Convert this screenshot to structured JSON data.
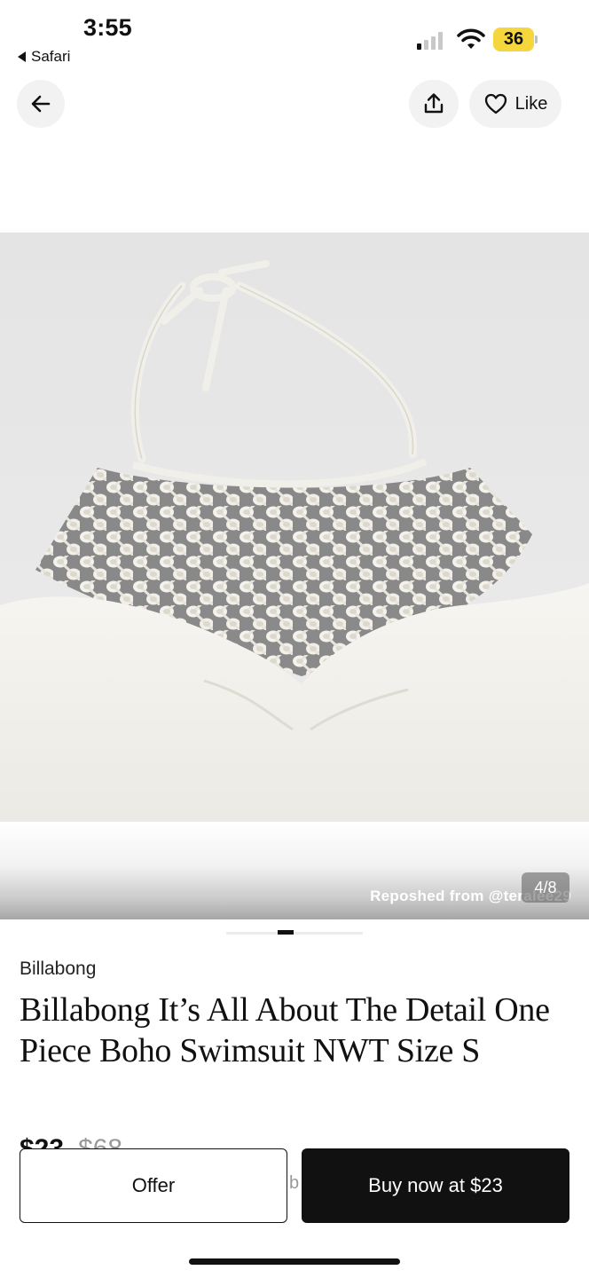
{
  "status_bar": {
    "time": "3:55",
    "back_app": "Safari",
    "battery": "36",
    "icons": [
      "signal-icon",
      "wifi-icon",
      "battery-icon"
    ]
  },
  "nav": {
    "back_icon": "arrow-left-icon",
    "share_icon": "share-icon",
    "like_icon": "heart-icon",
    "like_label": "Like"
  },
  "gallery": {
    "photo_subject": "white knotted macrame halter one-piece swimsuit",
    "repost_text": "Reposhed from @teralee29",
    "counter": "4/8",
    "current_index": 4,
    "total": 8
  },
  "product": {
    "brand": "Billabong",
    "title": "Billabong It’s All About The Detail One Piece Boho Swimsuit NWT Size S",
    "price": "$23",
    "original_price": "$68"
  },
  "actions": {
    "offer_label": "Offer",
    "buy_label": "Buy now at $23",
    "peek_text": "b"
  },
  "colors": {
    "accent_dark": "#111111",
    "battery": "#f5d63d",
    "nav_button_bg": "#f2f2f2"
  }
}
